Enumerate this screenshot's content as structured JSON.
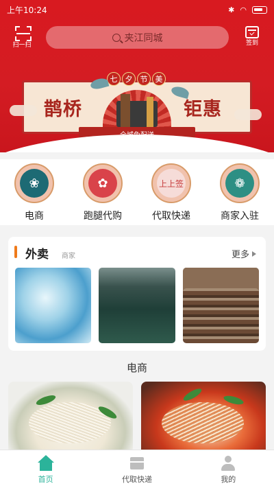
{
  "status_bar": {
    "time": "上午10:24",
    "battery": "5"
  },
  "header": {
    "scan_label": "扫一扫",
    "search_placeholder": "夹江同城",
    "signin_label": "签到"
  },
  "banner": {
    "tag_chars": [
      "七",
      "夕",
      "节",
      "美"
    ],
    "left_text": "鹊桥",
    "right_text": "钜惠",
    "ribbon_text": "全城免配送"
  },
  "categories": [
    {
      "label": "电商",
      "icon": "lion-dance-icon"
    },
    {
      "label": "跑腿代购",
      "icon": "runner-icon"
    },
    {
      "label": "代取快递",
      "icon": "express-icon",
      "glyph": "上上签"
    },
    {
      "label": "商家入驻",
      "icon": "flower-icon"
    }
  ],
  "takeaway": {
    "title": "外卖",
    "subtitle": "商家",
    "more_label": "更多"
  },
  "ecommerce": {
    "title": "电商"
  },
  "bottom_nav": {
    "items": [
      {
        "label": "首页",
        "icon": "home-icon",
        "active": true
      },
      {
        "label": "代取快递",
        "icon": "parcel-icon",
        "active": false
      },
      {
        "label": "我的",
        "icon": "user-icon",
        "active": false
      }
    ],
    "accent": "#2bb39a"
  },
  "colors": {
    "header_red": "#d81a20",
    "accent_orange": "#ef7a1a"
  }
}
